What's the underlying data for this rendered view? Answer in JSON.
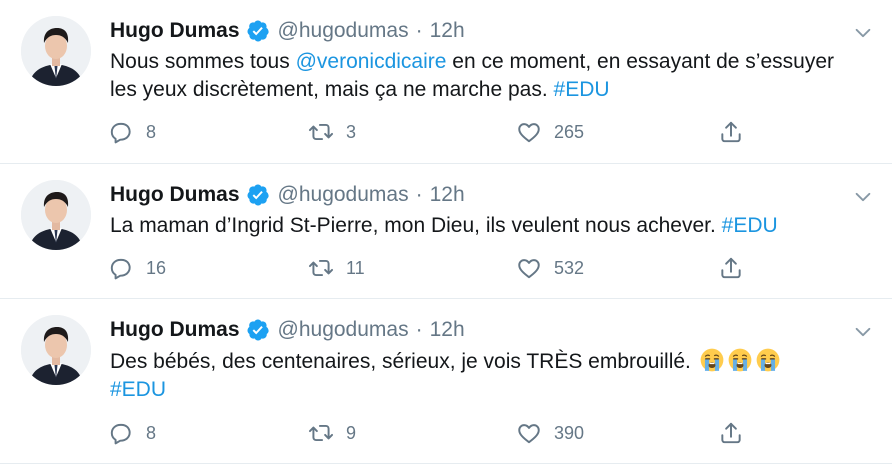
{
  "tweets": [
    {
      "author_name": "Hugo Dumas",
      "handle": "@hugodumas",
      "separator": "·",
      "time": "12h",
      "text_parts": [
        "Nous sommes tous ",
        "@veronicdicaire",
        " en ce moment, en essayant de s’essuyer les yeux discrètement, mais ça ne marche pas. ",
        "#EDU"
      ],
      "replies": "8",
      "retweets": "3",
      "likes": "265"
    },
    {
      "author_name": "Hugo Dumas",
      "handle": "@hugodumas",
      "separator": "·",
      "time": "12h",
      "text_parts": [
        "La maman d’Ingrid St-Pierre, mon Dieu, ils veulent nous achever. ",
        "#EDU"
      ],
      "replies": "16",
      "retweets": "11",
      "likes": "532"
    },
    {
      "author_name": "Hugo Dumas",
      "handle": "@hugodumas",
      "separator": "·",
      "time": "12h",
      "text_parts": [
        "Des bébés, des centenaires, sérieux, je vois TRÈS embrouillé. ",
        "#EDU"
      ],
      "emoji": [
        "crying-face-emoji",
        "crying-face-emoji",
        "crying-face-emoji"
      ],
      "replies": "8",
      "retweets": "9",
      "likes": "390"
    }
  ],
  "colors": {
    "link": "#1b95e0",
    "secondary_text": "#657786",
    "verified": "#1da1f2",
    "divider": "#e6ecf0"
  },
  "icons": [
    "avatar-photo",
    "verified-badge-icon",
    "chevron-down-icon",
    "reply-icon",
    "retweet-icon",
    "like-icon",
    "share-icon"
  ]
}
